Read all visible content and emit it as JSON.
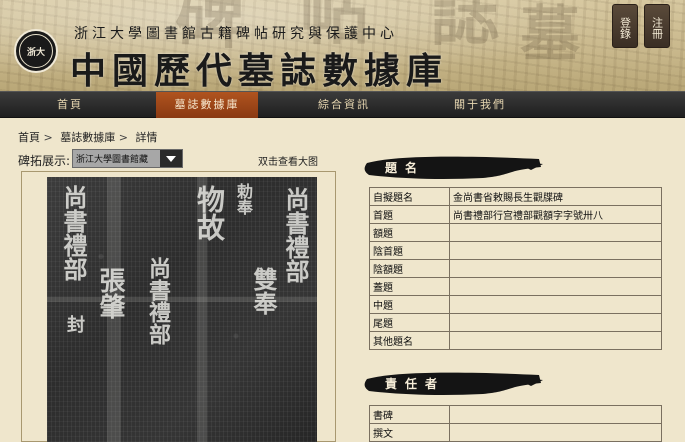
{
  "header": {
    "logo_text": "浙大",
    "subtitle": "浙江大學圖書館古籍碑帖研究與保護中心",
    "title": "中國歷代墓誌數據庫",
    "login_label": "登錄",
    "register_label": "注冊"
  },
  "nav": {
    "items": [
      {
        "label": "首頁"
      },
      {
        "label": "墓誌數據庫"
      },
      {
        "label": "綜合資訊"
      },
      {
        "label": "關于我們"
      }
    ],
    "active_index": 1
  },
  "breadcrumb": {
    "items": [
      "首頁",
      "墓誌數據庫",
      "詳情"
    ],
    "separator": ">"
  },
  "rubbing": {
    "label": "碑拓展示:",
    "selected_source": "浙江大學圖書館藏",
    "zoom_hint": "双击查看大图",
    "inscription_columns": [
      "尚書禮部",
      "張肇",
      "封",
      "勅奉",
      "物故",
      "雙奉",
      "尚書禮部",
      "尚書禮部"
    ]
  },
  "title_section": {
    "header": "題名",
    "rows": [
      {
        "key": "自擬題名",
        "value": "金尚書省敕賜長生觀牒碑"
      },
      {
        "key": "首題",
        "value": "尚書禮部行宫禮部觀額字字號卅八"
      },
      {
        "key": "額題",
        "value": ""
      },
      {
        "key": "陰首題",
        "value": ""
      },
      {
        "key": "陰額題",
        "value": ""
      },
      {
        "key": "蓋題",
        "value": ""
      },
      {
        "key": "中題",
        "value": ""
      },
      {
        "key": "尾題",
        "value": ""
      },
      {
        "key": "其他題名",
        "value": ""
      }
    ]
  },
  "responsible_section": {
    "header": "責任者",
    "rows": [
      {
        "key": "書碑",
        "value": ""
      },
      {
        "key": "撰文",
        "value": ""
      }
    ]
  }
}
